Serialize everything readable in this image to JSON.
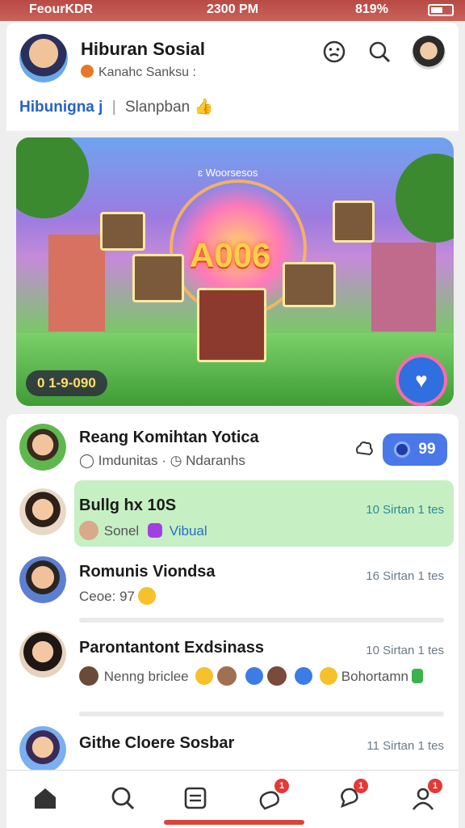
{
  "status_bar": {
    "carrier": "FeourKDR",
    "time": "2300 PM",
    "battery": "819%"
  },
  "header": {
    "title": "Hiburan Sosial",
    "subtitle": "Kanahc Sanksu :",
    "tab_primary": "Hibunigna j",
    "tab_secondary": "Slanpban",
    "icons": [
      "emoji-face-icon",
      "search-icon"
    ]
  },
  "hero": {
    "headline": "A006",
    "top_caption": "ɛ Woorsesos",
    "counter": "0 1-9-090",
    "colors": {
      "sky": "#6fa3f0",
      "grass": "#4fae3f",
      "ring": "#ffcf4a"
    }
  },
  "chats": [
    {
      "name": "Reang Komihtan Yotica",
      "meta_a": "Imdunitas",
      "meta_b": "Ndaranhs",
      "badge": "99",
      "badge_color": "#4a78e8"
    },
    {
      "name": "Bullg hx 10S",
      "meta_a": "Sonel",
      "meta_b": "Vibual",
      "time": "10 Sirtan 1 tes",
      "highlight_color": "#c6f0c3"
    },
    {
      "name": "Romunis Viondsa",
      "meta_a": "Ceoe: 97",
      "time": "16 Sirtan 1 tes"
    },
    {
      "name": "Parontantont Exdsinass",
      "meta_a": "Nenng briclee",
      "meta_b": "Bohortamn",
      "time": "10 Sirtan 1 tes"
    },
    {
      "name": "Githe Cloere Sosbar",
      "time": "11 Sirtan 1 tes"
    }
  ],
  "tabbar": {
    "badges": {
      "chat": "1",
      "notify": "1",
      "profile": "1"
    }
  }
}
